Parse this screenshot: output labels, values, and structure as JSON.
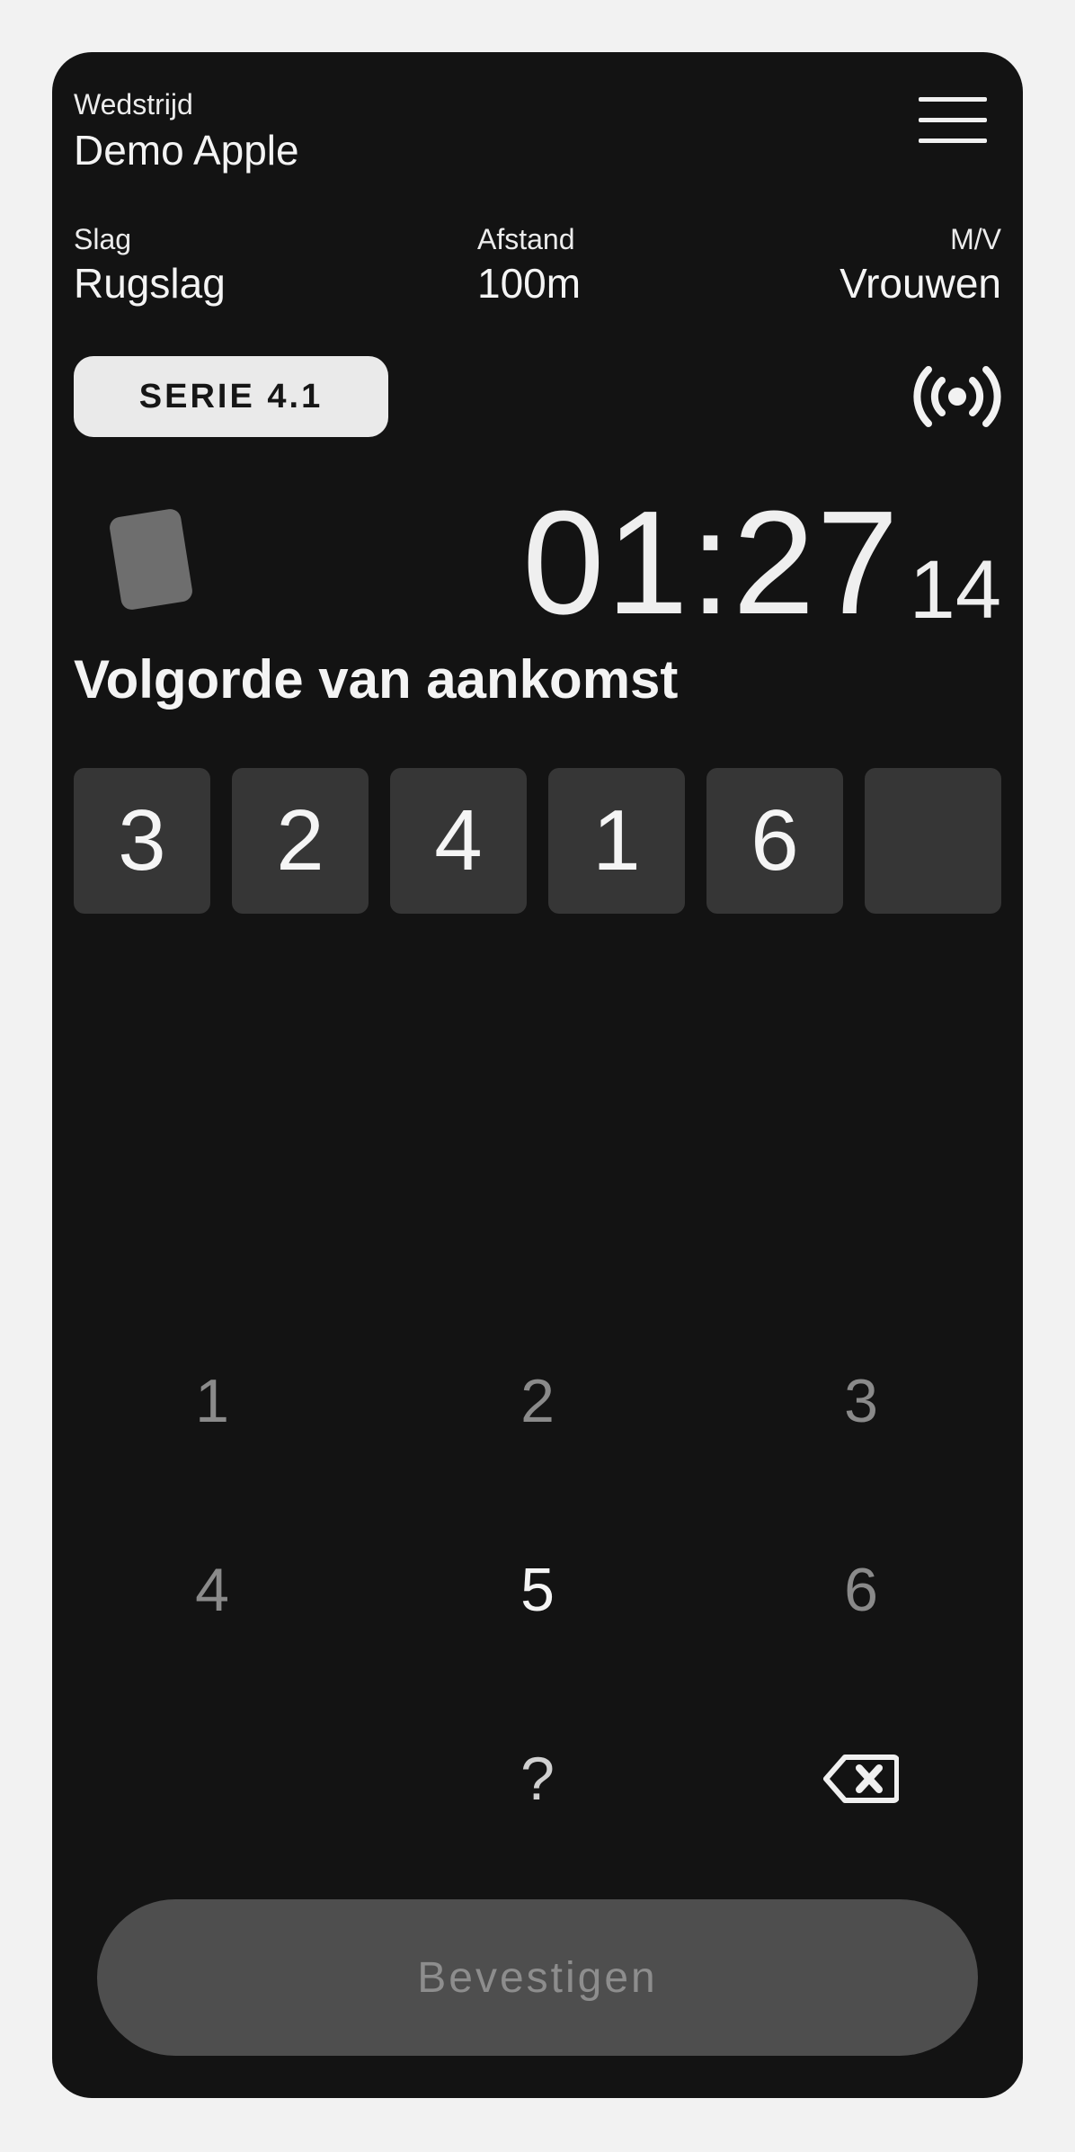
{
  "header": {
    "competition_label": "Wedstrijd",
    "competition_name": "Demo Apple"
  },
  "race_info": {
    "stroke_label": "Slag",
    "stroke_value": "Rugslag",
    "distance_label": "Afstand",
    "distance_value": "100m",
    "gender_label": "M/V",
    "gender_value": "Vrouwen"
  },
  "serie": {
    "label": "SERIE 4.1"
  },
  "timer": {
    "main": "01:27",
    "hundredths": "14"
  },
  "arrival": {
    "title": "Volgorde van aankomst",
    "slots": [
      "3",
      "2",
      "4",
      "1",
      "6",
      ""
    ]
  },
  "keypad": {
    "keys": [
      "1",
      "2",
      "3",
      "4",
      "5",
      "6",
      "?"
    ]
  },
  "confirm": {
    "label": "Bevestigen"
  },
  "colors": {
    "background": "#131313",
    "slot": "#363636",
    "button_disabled": "#4e4e4e"
  }
}
